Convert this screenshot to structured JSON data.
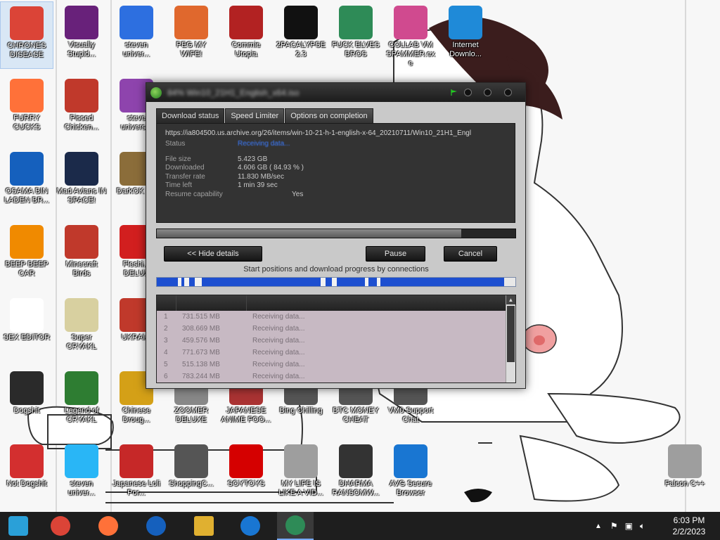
{
  "desktop": {
    "icons": [
      {
        "label": "CHRONES DISEASE",
        "icon": "chrome-icon",
        "color": "#db4437"
      },
      {
        "label": "Visually Stupid...",
        "icon": "visual-studio-icon",
        "color": "#68217a"
      },
      {
        "label": "steven univer...",
        "icon": "number-two-icon",
        "color": "#2d6fe0"
      },
      {
        "label": "PEG MY WIFE!",
        "icon": "peggle-icon",
        "color": "#e0682d"
      },
      {
        "label": "Commie Utopia",
        "icon": "hammer-sickle-icon",
        "color": "#b22222"
      },
      {
        "label": "2PACALYPSE 2.3",
        "icon": "console-icon",
        "color": "#111111"
      },
      {
        "label": "FUCK ELVES BROS",
        "icon": "santa-icon",
        "color": "#2e8b57"
      },
      {
        "label": "COLLAB VM SPAMMER.exe",
        "icon": "monitor-icon",
        "color": "#d04a8f"
      },
      {
        "label": "Internet Downlo...",
        "icon": "idm-globe-icon",
        "color": "#1f8ad8"
      },
      {
        "label": "FURRY CUCKS",
        "icon": "firefox-icon",
        "color": "#ff7139"
      },
      {
        "label": "Pissed Chicken...",
        "icon": "angry-birds-seasons-icon",
        "color": "#c0392b"
      },
      {
        "label": "steve univers...",
        "icon": "gem-icon",
        "color": "#8e44ad"
      },
      {
        "label": "OSAMA BIN LADEN BR...",
        "icon": "obama-logo-icon",
        "color": "#1560bd"
      },
      {
        "label": "Mad Avians IN SPACE!",
        "icon": "angry-birds-space-icon",
        "color": "#1b2a4a"
      },
      {
        "label": "DarkOK F...",
        "icon": "money-bag-icon",
        "color": "#8b6d3a"
      },
      {
        "label": "BEEP BEEP CAR",
        "icon": "vlc-cone-icon",
        "color": "#f08a00"
      },
      {
        "label": "Minecraft Birds",
        "icon": "angry-birds-icon",
        "color": "#c0392b"
      },
      {
        "label": "Fleshi... DELUX",
        "icon": "red-creature-icon",
        "color": "#d21f1f"
      },
      {
        "label": "SEX EDITOR",
        "icon": "hxd-icon",
        "color": "#ffffff"
      },
      {
        "label": "Super CRYAKL",
        "icon": "pixel-art-icon",
        "color": "#d8d0a0"
      },
      {
        "label": "UKRAI...",
        "icon": "radiation-icon",
        "color": "#c0392b"
      },
      {
        "label": "Dogshit",
        "icon": "codeblocks-icon",
        "color": "#2a2a2a"
      },
      {
        "label": "Legend of CRYAKL",
        "icon": "pixel-character-icon",
        "color": "#2e7d32"
      },
      {
        "label": "Chinese Droug...",
        "icon": "book-icon",
        "color": "#d4a017"
      },
      {
        "label": "ZOOMER DELUXE",
        "icon": "zoomer-icon",
        "color": "#888888"
      },
      {
        "label": "JAPANESE ANIME FOO...",
        "icon": "anime-icon",
        "color": "#aa3333"
      },
      {
        "label": "Bing Chilling",
        "icon": "bing-icon",
        "color": "#555555"
      },
      {
        "label": "BTC MONEY CHEAT",
        "icon": "btc-icon",
        "color": "#555555"
      },
      {
        "label": "VM0 Support Chat",
        "icon": "chat-icon",
        "color": "#555555"
      },
      {
        "label": "Not Dogshit",
        "icon": "dev-cpp-icon",
        "color": "#d32f2f"
      },
      {
        "label": "steven univer...",
        "icon": "diamond-icon",
        "color": "#29b6f6"
      },
      {
        "label": "Japanese Loli Por...",
        "icon": "torii-icon",
        "color": "#c62828"
      },
      {
        "label": "ShoppingC...",
        "icon": "flash-icon",
        "color": "#555555"
      },
      {
        "label": "SOYTOYS",
        "icon": "s-logo-icon",
        "color": "#d50000"
      },
      {
        "label": "MY LIFE IS LIKE A VID...",
        "icon": "gamepad-icon",
        "color": "#9e9e9e"
      },
      {
        "label": "DHARMA RANSOMW...",
        "icon": "skull-icon",
        "color": "#333333"
      },
      {
        "label": "AVG Secure Browser",
        "icon": "avg-icon",
        "color": "#1976d2"
      },
      {
        "label": "Falcon C++",
        "icon": "recycle-bin-icon",
        "color": "#9e9e9e"
      }
    ]
  },
  "dialog": {
    "tabs": [
      "Download status",
      "Speed Limiter",
      "Options on completion"
    ],
    "url": "https://ia804500.us.archive.org/26/items/win-10-21-h-1-english-x-64_20210711/Win10_21H1_Engl",
    "status_label": "Status",
    "status_value": "Receiving data...",
    "fields": [
      {
        "key": "File size",
        "value": "5.423 GB"
      },
      {
        "key": "Downloaded",
        "value": "4.606 GB  ( 84.93 % )"
      },
      {
        "key": "Transfer rate",
        "value": "11.830 MB/sec"
      },
      {
        "key": "Time left",
        "value": "1 min 39 sec"
      }
    ],
    "resume_label": "Resume capability",
    "resume_value": "Yes",
    "progress": 0.8493,
    "hide_details": "<< Hide details",
    "pause": "Pause",
    "cancel": "Cancel",
    "connections_caption": "Start positions and download progress by connections",
    "connections": [
      {
        "n": "1",
        "downloaded": "731.515 MB",
        "info": "Receiving data..."
      },
      {
        "n": "2",
        "downloaded": "308.669 MB",
        "info": "Receiving data..."
      },
      {
        "n": "3",
        "downloaded": "459.576 MB",
        "info": "Receiving data..."
      },
      {
        "n": "4",
        "downloaded": "771.673 MB",
        "info": "Receiving data..."
      },
      {
        "n": "5",
        "downloaded": "515.138 MB",
        "info": "Receiving data..."
      },
      {
        "n": "6",
        "downloaded": "783.244 MB",
        "info": "Receiving data..."
      }
    ]
  },
  "taskbar": {
    "items": [
      {
        "icon": "start-icon"
      },
      {
        "icon": "chrome-icon"
      },
      {
        "icon": "firefox-icon"
      },
      {
        "icon": "obama-logo-icon"
      },
      {
        "icon": "file-explorer-icon"
      },
      {
        "icon": "avg-icon"
      },
      {
        "icon": "idm-icon"
      }
    ],
    "time": "6:03 PM",
    "date": "2/2/2023"
  }
}
